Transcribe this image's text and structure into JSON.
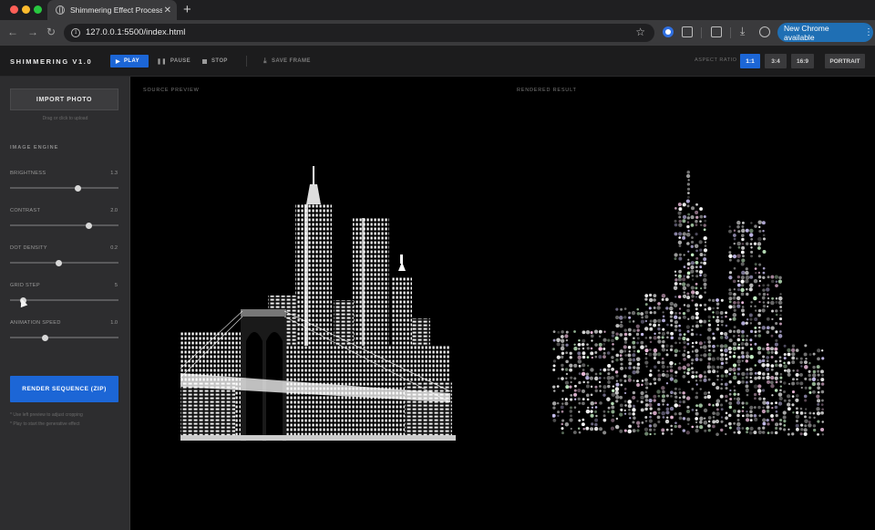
{
  "browser": {
    "tab_title": "Shimmering Effect Processing",
    "url": "127.0.0.1:5500/index.html",
    "update_label": "New Chrome available"
  },
  "header": {
    "brand": "SHIMMERING V1.0",
    "play_label": "PLAY",
    "pause_label": "PAUSE",
    "stop_label": "STOP",
    "save_label": "SAVE FRAME",
    "aspect_label": "ASPECT RATIO",
    "aspect_options": [
      "1:1",
      "3:4",
      "16:9",
      "PORTRAIT"
    ],
    "aspect_selected": "1:1",
    "accent_color": "#1c66d6"
  },
  "sidebar": {
    "import_label": "IMPORT PHOTO",
    "import_hint": "Drag or click to upload",
    "engine_title": "IMAGE ENGINE",
    "controls": [
      {
        "label": "BRIGHTNESS",
        "value": "1.3",
        "level": 0.63
      },
      {
        "label": "CONTRAST",
        "value": "2.0",
        "level": 0.74
      },
      {
        "label": "DOT DENSITY",
        "value": "0.2",
        "level": 0.45
      },
      {
        "label": "GRID STEP",
        "value": "5",
        "level": 0.1
      },
      {
        "label": "ANIMATION SPEED",
        "value": "1.0",
        "level": 0.31
      }
    ],
    "render_label": "RENDER SEQUENCE (ZIP)",
    "notes": [
      "* Use left preview to adjust cropping",
      "* Play to start the generative effect"
    ]
  },
  "main": {
    "source_label": "SOURCE PREVIEW",
    "result_label": "RENDERED RESULT"
  }
}
